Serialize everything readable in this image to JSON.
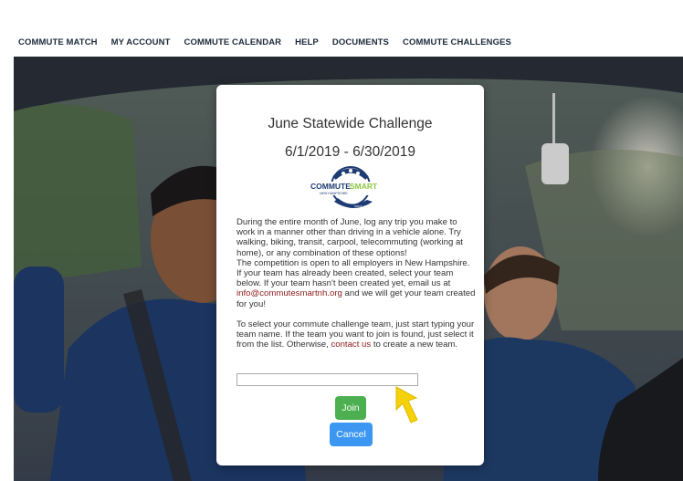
{
  "nav": {
    "items": [
      {
        "label": "COMMUTE MATCH"
      },
      {
        "label": "MY ACCOUNT"
      },
      {
        "label": "COMMUTE CALENDAR"
      },
      {
        "label": "HELP"
      },
      {
        "label": "DOCUMENTS"
      },
      {
        "label": "COMMUTE CHALLENGES"
      }
    ]
  },
  "modal": {
    "title": "June Statewide Challenge",
    "dates": "6/1/2019 - 6/30/2019",
    "logo": {
      "brand_part1": "COMMUTE",
      "brand_part2": "SMART",
      "region": "NEW HAMPSHIRE",
      "badge": "SINCE 2007",
      "icon": "commutesmart-logo-icon"
    },
    "paragraph1": [
      "During the entire month of June, log any trip you make to work in a manner other than driving in a vehicle alone. Try walking, biking, transit, carpool, telecommuting (working at home), or any combination of these options!"
    ],
    "paragraph2_before": "The competition is open to all employers in New Hampshire. If your team has already been created, select your team below. If your team hasn't been created yet, email us at ",
    "email": "info@commutesmartnh.org",
    "paragraph2_after": " and we will get your team created for you!",
    "paragraph3_before": "To select your commute challenge team, just start typing your team name. If the team you want to join is found, just select it from the list. Otherwise, ",
    "contact_link": "contact us",
    "paragraph3_after": " to create a new team.",
    "team_input_value": "",
    "join_label": "Join",
    "cancel_label": "Cancel"
  },
  "colors": {
    "join": "#4cb050",
    "cancel": "#3b97f2",
    "link": "#8b1a1a",
    "cursor": "#f5d10a",
    "logo_blue": "#1f3b73",
    "logo_green": "#8cc63f"
  },
  "cursor_icon": "pointer-hand-icon"
}
